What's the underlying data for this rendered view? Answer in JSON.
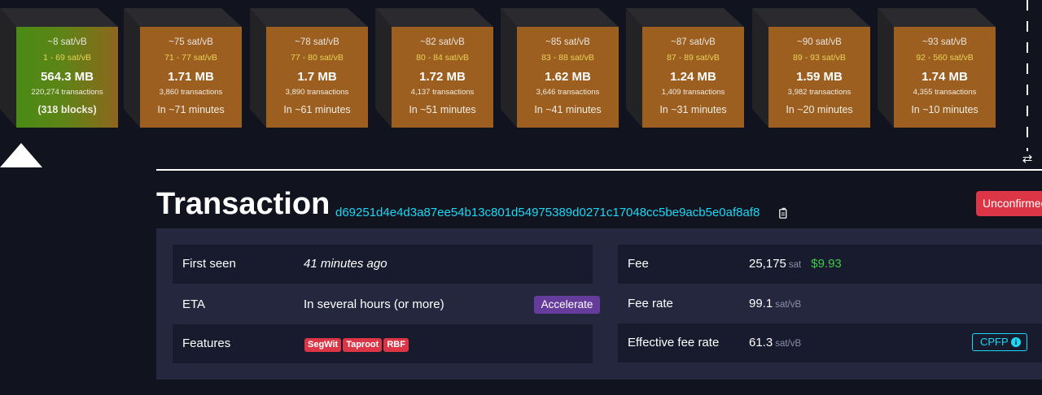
{
  "mempool_blocks": [
    {
      "median": "~8 sat/vB",
      "range": "1 - 69 sat/vB",
      "size": "564.3 MB",
      "txs": "220,274 transactions",
      "eta": "(318 blocks)"
    },
    {
      "median": "~75 sat/vB",
      "range": "71 - 77 sat/vB",
      "size": "1.71 MB",
      "txs": "3,860 transactions",
      "eta": "In ~71 minutes"
    },
    {
      "median": "~78 sat/vB",
      "range": "77 - 80 sat/vB",
      "size": "1.7 MB",
      "txs": "3,890 transactions",
      "eta": "In ~61 minutes"
    },
    {
      "median": "~82 sat/vB",
      "range": "80 - 84 sat/vB",
      "size": "1.72 MB",
      "txs": "4,137 transactions",
      "eta": "In ~51 minutes"
    },
    {
      "median": "~85 sat/vB",
      "range": "83 - 88 sat/vB",
      "size": "1.62 MB",
      "txs": "3,646 transactions",
      "eta": "In ~41 minutes"
    },
    {
      "median": "~87 sat/vB",
      "range": "87 - 89 sat/vB",
      "size": "1.24 MB",
      "txs": "1,409 transactions",
      "eta": "In ~31 minutes"
    },
    {
      "median": "~90 sat/vB",
      "range": "89 - 93 sat/vB",
      "size": "1.59 MB",
      "txs": "3,982 transactions",
      "eta": "In ~20 minutes"
    },
    {
      "median": "~93 sat/vB",
      "range": "92 - 560 sat/vB",
      "size": "1.74 MB",
      "txs": "4,355 transactions",
      "eta": "In ~10 minutes"
    }
  ],
  "swap_icon": "⇄",
  "transaction": {
    "title": "Transaction",
    "txid": "d69251d4e4d3a87ee54b13c801d54975389d0271c17048cc5be9acb5e0af8af8",
    "status": "Unconfirmed"
  },
  "details": {
    "first_seen": {
      "label": "First seen",
      "value": "41 minutes ago"
    },
    "eta": {
      "label": "ETA",
      "value": "In several hours (or more)",
      "button": "Accelerate"
    },
    "features": {
      "label": "Features",
      "badges": [
        "SegWit",
        "Taproot",
        "RBF"
      ]
    },
    "fee": {
      "label": "Fee",
      "value": "25,175",
      "unit": "sat",
      "usd": "$9.93"
    },
    "fee_rate": {
      "label": "Fee rate",
      "value": "99.1",
      "unit": "sat/vB"
    },
    "effective_fee_rate": {
      "label": "Effective fee rate",
      "value": "61.3",
      "unit": "sat/vB",
      "button": "CPFP"
    }
  },
  "colors": {
    "background": "#11131f",
    "block_face": "#9c5f1f",
    "accent_cyan": "#1bd8f4",
    "badge_red": "#dc3545",
    "accelerate_purple": "#653b9c",
    "usd_green": "#3bcc49"
  }
}
